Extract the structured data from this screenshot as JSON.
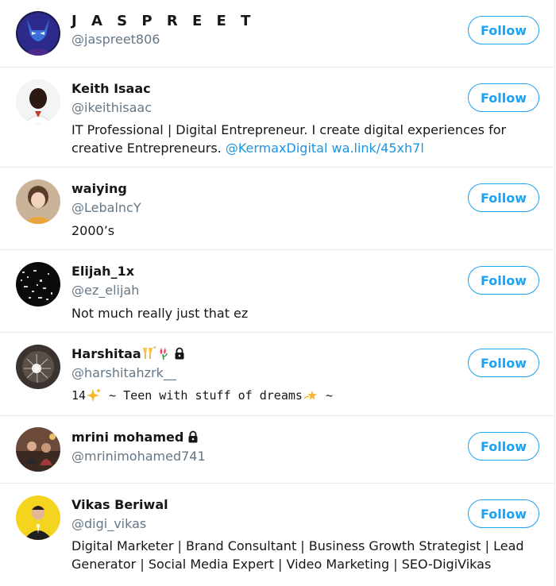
{
  "accent_color": "#1da1f2",
  "follow_label": "Follow",
  "users": [
    {
      "name": "J A S P R E E T",
      "handle": "@jaspreet806",
      "bio": ""
    },
    {
      "name": "Keith Isaac",
      "handle": "@ikeithisaac",
      "bio": "IT Professional | Digital Entrepreneur. I create digital experiences for creative Entrepreneurs.",
      "bio_mention": "@KermaxDigital",
      "bio_link": "wa.link/45xh7l"
    },
    {
      "name": "waiying",
      "handle": "@LebalncY",
      "bio": "2000’s"
    },
    {
      "name": "Elijah_1x",
      "handle": "@ez_elijah",
      "bio": "Not much really just that ez"
    },
    {
      "name": "Harshitaa",
      "handle": "@harshitahzrk__",
      "bio_pre": "14",
      "bio": " ~ Teen with stuff of dreams",
      "bio_post": " ~",
      "name_icons": [
        "cheers-icon",
        "tulip-icon",
        "lock-icon"
      ],
      "bio_icons": [
        "sparkles-icon",
        "dizzy-star-icon"
      ]
    },
    {
      "name": "mrini mohamed",
      "handle": "@mrinimohamed741",
      "bio": "",
      "name_icons": [
        "lock-icon"
      ]
    },
    {
      "name": "Vikas Beriwal",
      "handle": "@digi_vikas",
      "bio": "Digital Marketer | Brand Consultant | Business Growth Strategist | Lead Generator | Social Media Expert | Video Marketing | SEO-DigiVikas"
    }
  ]
}
